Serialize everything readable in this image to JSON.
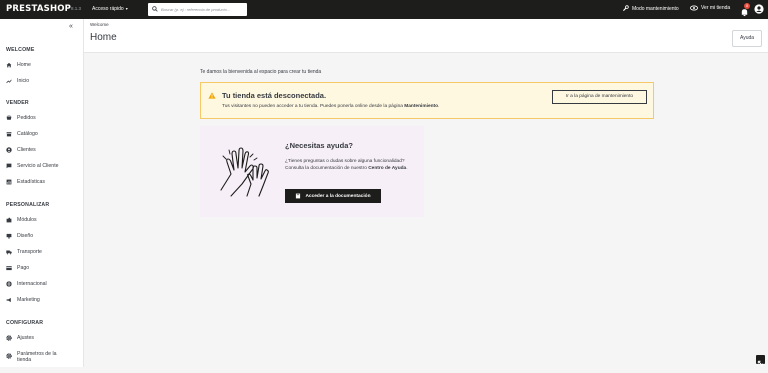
{
  "topbar": {
    "brand": "PRESTASHOP",
    "version": "8.1.3",
    "quick_access": "Acceso rápido",
    "search_placeholder": "Buscar (p. ej.: referencia de producto...",
    "maintenance_mode": "Modo mantenimiento",
    "view_shop": "Ver mi tienda",
    "notifications_count": "0"
  },
  "sidebar": {
    "sections": [
      {
        "title": "WELCOME",
        "items": [
          {
            "label": "Home",
            "icon": "home-icon"
          },
          {
            "label": "Inicio",
            "icon": "trending-icon"
          }
        ]
      },
      {
        "title": "VENDER",
        "items": [
          {
            "label": "Pedidos",
            "icon": "cart-icon"
          },
          {
            "label": "Catálogo",
            "icon": "store-icon"
          },
          {
            "label": "Clientes",
            "icon": "account-icon"
          },
          {
            "label": "Servicio al Cliente",
            "icon": "chat-icon"
          },
          {
            "label": "Estadísticas",
            "icon": "chart-icon"
          }
        ]
      },
      {
        "title": "PERSONALIZAR",
        "items": [
          {
            "label": "Módulos",
            "icon": "puzzle-icon"
          },
          {
            "label": "Diseño",
            "icon": "desktop-icon"
          },
          {
            "label": "Transporte",
            "icon": "truck-icon"
          },
          {
            "label": "Pago",
            "icon": "card-icon"
          },
          {
            "label": "Internacional",
            "icon": "globe-icon"
          },
          {
            "label": "Marketing",
            "icon": "megaphone-icon"
          }
        ]
      },
      {
        "title": "CONFIGURAR",
        "items": [
          {
            "label": "Ajustes",
            "icon": "gear-icon"
          },
          {
            "label": "Parámetros de la tienda",
            "icon": "gear-icon"
          }
        ]
      }
    ]
  },
  "header": {
    "breadcrumb": "Welcome",
    "title": "Home",
    "help_label": "Ayuda"
  },
  "main": {
    "welcome_text": "Te damos la bienvenida al espacio para crear tu tienda",
    "alert": {
      "title": "Tu tienda está desconectada.",
      "text_prefix": "Tus visitantes no pueden acceder a tu tienda. Puedes ponerla online desde la página ",
      "text_bold": "Mantenimiento",
      "text_suffix": ".",
      "button": "Ir a la página de mantenimiento"
    },
    "help_card": {
      "title": "¿Necesitas ayuda?",
      "text_prefix": "¿Tienes preguntas o dudas sobre alguna funcionalidad? Consulta la documentación de nuestro ",
      "text_bold": "Centro de Ayuda",
      "text_suffix": ".",
      "button": "Acceder a la documentación"
    }
  }
}
